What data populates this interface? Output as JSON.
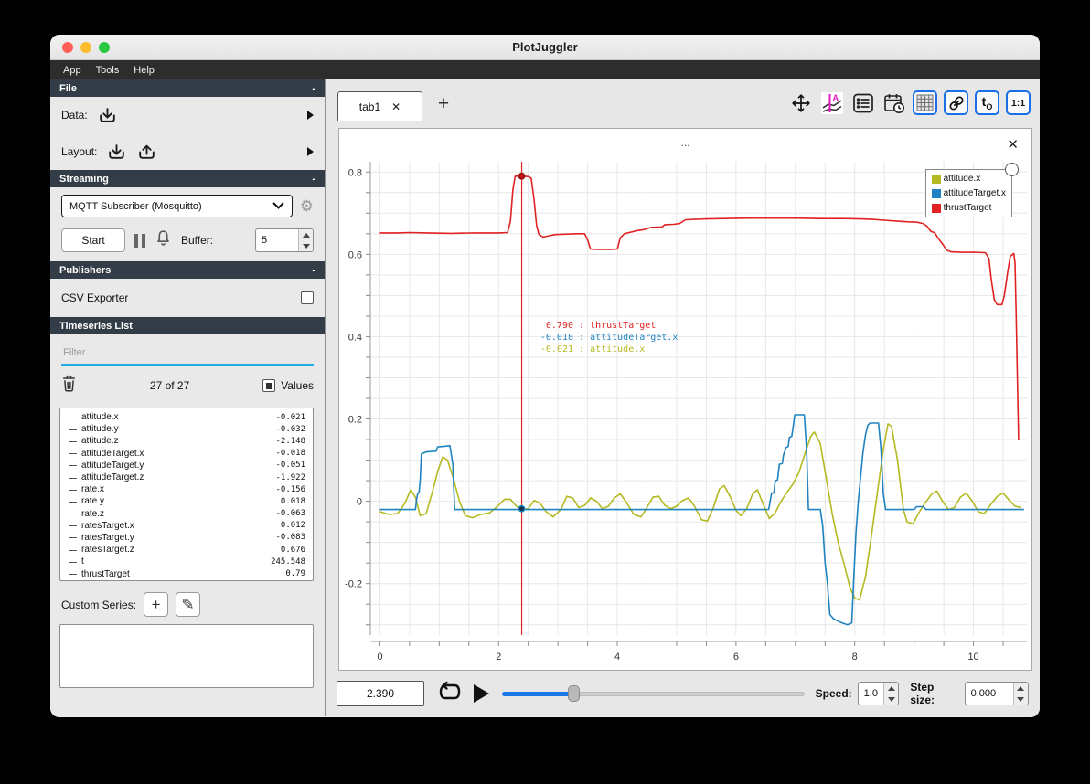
{
  "window": {
    "title": "PlotJuggler",
    "menu": [
      "App",
      "Tools",
      "Help"
    ],
    "traffic_lights": [
      "#ff5f57",
      "#febc2e",
      "#28c840"
    ]
  },
  "sidebar": {
    "file": {
      "header": "File",
      "collapse": "-",
      "data_label": "Data:",
      "layout_label": "Layout:"
    },
    "streaming": {
      "header": "Streaming",
      "collapse": "-",
      "source_selected": "MQTT Subscriber (Mosquitto)",
      "start_label": "Start",
      "buffer_label": "Buffer:",
      "buffer_value": "5"
    },
    "publishers": {
      "header": "Publishers",
      "collapse": "-",
      "csv_label": "CSV Exporter"
    },
    "timeseries": {
      "header": "Timeseries List",
      "filter_placeholder": "Filter...",
      "count": "27 of 27",
      "values_label": "Values",
      "items": [
        {
          "name": "attitude.x",
          "value": "-0.021"
        },
        {
          "name": "attitude.y",
          "value": "-0.032"
        },
        {
          "name": "attitude.z",
          "value": "-2.148"
        },
        {
          "name": "attitudeTarget.x",
          "value": "-0.018"
        },
        {
          "name": "attitudeTarget.y",
          "value": "-0.051"
        },
        {
          "name": "attitudeTarget.z",
          "value": "-1.922"
        },
        {
          "name": "rate.x",
          "value": "-0.156"
        },
        {
          "name": "rate.y",
          "value": "0.018"
        },
        {
          "name": "rate.z",
          "value": "-0.063"
        },
        {
          "name": "ratesTarget.x",
          "value": "0.012"
        },
        {
          "name": "ratesTarget.y",
          "value": "-0.083"
        },
        {
          "name": "ratesTarget.z",
          "value": "0.676"
        },
        {
          "name": "t",
          "value": "245.548"
        },
        {
          "name": "thrustTarget",
          "value": "0.79"
        }
      ]
    },
    "custom_series": {
      "label": "Custom Series:",
      "add_glyph": "+",
      "edit_glyph": "✎"
    }
  },
  "tabbar": {
    "active_tab": "tab1",
    "close_glyph": "✕",
    "add_glyph": "+"
  },
  "plot": {
    "title": "...",
    "close_glyph": "✕",
    "legend": [
      {
        "label": "attitude.x",
        "color": "#b4b921"
      },
      {
        "label": "attitudeTarget.x",
        "color": "#1f83c1"
      },
      {
        "label": "thrustTarget",
        "color": "#e02222"
      }
    ],
    "tooltip": [
      {
        "value": "0.790",
        "name": "thrustTarget",
        "color": "#e02222"
      },
      {
        "value": "-0.018",
        "name": "attitudeTarget.x",
        "color": "#1f83c1"
      },
      {
        "value": "-0.021",
        "name": "attitude.x",
        "color": "#b4b921"
      }
    ]
  },
  "chart_data": {
    "type": "line",
    "xlim": [
      -0.16,
      10.9
    ],
    "ylim": [
      -0.325,
      0.825
    ],
    "x_ticks": [
      0,
      2,
      4,
      6,
      8,
      10
    ],
    "y_ticks": [
      0.8,
      0.6,
      0.4,
      0.2,
      0,
      -0.2
    ],
    "x_minor": 0.5,
    "y_minor": 0.05,
    "grid": true,
    "legend_position": "top-right",
    "tracker": {
      "t": 2.39,
      "dots": [
        {
          "v": 0.79,
          "fill": "#c41717",
          "stroke": "#8a0f0f"
        },
        {
          "v": -0.018,
          "fill": "#12364e",
          "stroke": "#1f83c1"
        }
      ]
    },
    "series": [
      {
        "name": "attitude.x",
        "color": "#b4b921",
        "points": [
          [
            0,
            -0.025
          ],
          [
            0.15,
            -0.032
          ],
          [
            0.3,
            -0.03
          ],
          [
            0.42,
            -0.005
          ],
          [
            0.52,
            0.028
          ],
          [
            0.6,
            0.01
          ],
          [
            0.68,
            -0.035
          ],
          [
            0.78,
            -0.03
          ],
          [
            0.88,
            0.02
          ],
          [
            0.98,
            0.075
          ],
          [
            1.06,
            0.108
          ],
          [
            1.14,
            0.1
          ],
          [
            1.24,
            0.055
          ],
          [
            1.34,
            0
          ],
          [
            1.44,
            -0.035
          ],
          [
            1.56,
            -0.04
          ],
          [
            1.7,
            -0.032
          ],
          [
            1.85,
            -0.028
          ],
          [
            2,
            -0.01
          ],
          [
            2.1,
            0.005
          ],
          [
            2.2,
            0.005
          ],
          [
            2.3,
            -0.012
          ],
          [
            2.39,
            -0.021
          ],
          [
            2.5,
            -0.018
          ],
          [
            2.6,
            0.002
          ],
          [
            2.7,
            -0.005
          ],
          [
            2.8,
            -0.025
          ],
          [
            2.92,
            -0.038
          ],
          [
            3.05,
            -0.02
          ],
          [
            3.15,
            0.012
          ],
          [
            3.25,
            0.008
          ],
          [
            3.35,
            -0.015
          ],
          [
            3.45,
            -0.01
          ],
          [
            3.55,
            0.008
          ],
          [
            3.65,
            0
          ],
          [
            3.75,
            -0.018
          ],
          [
            3.85,
            -0.012
          ],
          [
            3.95,
            0.008
          ],
          [
            4.05,
            0.018
          ],
          [
            4.15,
            -0.002
          ],
          [
            4.28,
            -0.032
          ],
          [
            4.4,
            -0.038
          ],
          [
            4.5,
            -0.015
          ],
          [
            4.6,
            0.01
          ],
          [
            4.7,
            0.012
          ],
          [
            4.8,
            -0.01
          ],
          [
            4.9,
            -0.018
          ],
          [
            5,
            -0.012
          ],
          [
            5.1,
            0.002
          ],
          [
            5.2,
            0.008
          ],
          [
            5.3,
            -0.012
          ],
          [
            5.42,
            -0.045
          ],
          [
            5.52,
            -0.048
          ],
          [
            5.62,
            -0.015
          ],
          [
            5.72,
            0.03
          ],
          [
            5.8,
            0.038
          ],
          [
            5.9,
            0.012
          ],
          [
            6,
            -0.022
          ],
          [
            6.08,
            -0.035
          ],
          [
            6.18,
            -0.018
          ],
          [
            6.28,
            0.018
          ],
          [
            6.36,
            0.028
          ],
          [
            6.46,
            -0.008
          ],
          [
            6.56,
            -0.042
          ],
          [
            6.66,
            -0.028
          ],
          [
            6.76,
            0
          ],
          [
            6.86,
            0.022
          ],
          [
            6.96,
            0.042
          ],
          [
            7.06,
            0.07
          ],
          [
            7.16,
            0.115
          ],
          [
            7.26,
            0.158
          ],
          [
            7.32,
            0.168
          ],
          [
            7.42,
            0.14
          ],
          [
            7.52,
            0.055
          ],
          [
            7.62,
            -0.03
          ],
          [
            7.72,
            -0.1
          ],
          [
            7.82,
            -0.152
          ],
          [
            7.92,
            -0.21
          ],
          [
            8,
            -0.235
          ],
          [
            8.08,
            -0.24
          ],
          [
            8.18,
            -0.185
          ],
          [
            8.28,
            -0.085
          ],
          [
            8.38,
            0.02
          ],
          [
            8.48,
            0.125
          ],
          [
            8.56,
            0.188
          ],
          [
            8.62,
            0.182
          ],
          [
            8.72,
            0.1
          ],
          [
            8.82,
            -0.02
          ],
          [
            8.88,
            -0.05
          ],
          [
            8.98,
            -0.055
          ],
          [
            9.08,
            -0.028
          ],
          [
            9.18,
            -0.005
          ],
          [
            9.3,
            0.018
          ],
          [
            9.38,
            0.025
          ],
          [
            9.48,
            0
          ],
          [
            9.58,
            -0.02
          ],
          [
            9.68,
            -0.015
          ],
          [
            9.78,
            0.01
          ],
          [
            9.88,
            0.02
          ],
          [
            9.98,
            0
          ],
          [
            10.08,
            -0.025
          ],
          [
            10.18,
            -0.03
          ],
          [
            10.28,
            -0.01
          ],
          [
            10.4,
            0.012
          ],
          [
            10.5,
            0.02
          ],
          [
            10.6,
            0.003
          ],
          [
            10.7,
            -0.012
          ],
          [
            10.8,
            -0.015
          ]
        ]
      },
      {
        "name": "attitudeTarget.x",
        "color": "#1f83c1",
        "points": [
          [
            0,
            -0.02
          ],
          [
            0.6,
            -0.02
          ],
          [
            0.62,
            0.005
          ],
          [
            0.64,
            0.02
          ],
          [
            0.66,
            0.02
          ],
          [
            0.68,
            0.05
          ],
          [
            0.7,
            0.115
          ],
          [
            0.78,
            0.12
          ],
          [
            0.95,
            0.122
          ],
          [
            0.97,
            0.132
          ],
          [
            1.18,
            0.135
          ],
          [
            1.23,
            0.09
          ],
          [
            1.26,
            -0.02
          ],
          [
            6.55,
            -0.02
          ],
          [
            6.58,
            0.005
          ],
          [
            6.6,
            0.02
          ],
          [
            6.64,
            0.02
          ],
          [
            6.66,
            0.05
          ],
          [
            6.7,
            0.052
          ],
          [
            6.73,
            0.09
          ],
          [
            6.78,
            0.092
          ],
          [
            6.8,
            0.112
          ],
          [
            6.84,
            0.13
          ],
          [
            6.88,
            0.133
          ],
          [
            6.9,
            0.155
          ],
          [
            6.94,
            0.158
          ],
          [
            6.96,
            0.178
          ],
          [
            6.99,
            0.21
          ],
          [
            7.15,
            0.21
          ],
          [
            7.19,
            0.12
          ],
          [
            7.22,
            -0.02
          ],
          [
            7.42,
            -0.02
          ],
          [
            7.46,
            -0.06
          ],
          [
            7.5,
            -0.15
          ],
          [
            7.54,
            -0.2
          ],
          [
            7.58,
            -0.275
          ],
          [
            7.64,
            -0.285
          ],
          [
            7.7,
            -0.29
          ],
          [
            7.78,
            -0.295
          ],
          [
            7.88,
            -0.3
          ],
          [
            7.95,
            -0.295
          ],
          [
            7.98,
            -0.2
          ],
          [
            8.02,
            -0.08
          ],
          [
            8.06,
            0
          ],
          [
            8.1,
            0.06
          ],
          [
            8.14,
            0.12
          ],
          [
            8.18,
            0.16
          ],
          [
            8.22,
            0.185
          ],
          [
            8.26,
            0.19
          ],
          [
            8.4,
            0.19
          ],
          [
            8.44,
            0.13
          ],
          [
            8.48,
            0.02
          ],
          [
            8.52,
            -0.02
          ],
          [
            9,
            -0.02
          ],
          [
            9.04,
            -0.013
          ],
          [
            9.16,
            -0.013
          ],
          [
            9.2,
            -0.02
          ],
          [
            10.85,
            -0.02
          ]
        ]
      },
      {
        "name": "thrustTarget",
        "color": "#e02222",
        "points": [
          [
            0,
            0.652
          ],
          [
            0.3,
            0.652
          ],
          [
            0.5,
            0.653
          ],
          [
            0.8,
            0.652
          ],
          [
            1.2,
            0.651
          ],
          [
            1.6,
            0.652
          ],
          [
            2,
            0.652
          ],
          [
            2.15,
            0.653
          ],
          [
            2.2,
            0.68
          ],
          [
            2.24,
            0.755
          ],
          [
            2.28,
            0.79
          ],
          [
            2.39,
            0.79
          ],
          [
            2.5,
            0.789
          ],
          [
            2.55,
            0.785
          ],
          [
            2.6,
            0.73
          ],
          [
            2.64,
            0.67
          ],
          [
            2.68,
            0.648
          ],
          [
            2.75,
            0.642
          ],
          [
            2.85,
            0.645
          ],
          [
            2.95,
            0.648
          ],
          [
            3.1,
            0.649
          ],
          [
            3.3,
            0.65
          ],
          [
            3.45,
            0.65
          ],
          [
            3.5,
            0.635
          ],
          [
            3.55,
            0.613
          ],
          [
            3.65,
            0.612
          ],
          [
            3.9,
            0.612
          ],
          [
            4,
            0.613
          ],
          [
            4.05,
            0.64
          ],
          [
            4.12,
            0.65
          ],
          [
            4.2,
            0.653
          ],
          [
            4.35,
            0.658
          ],
          [
            4.45,
            0.66
          ],
          [
            4.55,
            0.665
          ],
          [
            4.65,
            0.666
          ],
          [
            4.75,
            0.666
          ],
          [
            4.8,
            0.672
          ],
          [
            4.95,
            0.673
          ],
          [
            5.05,
            0.675
          ],
          [
            5.15,
            0.684
          ],
          [
            5.3,
            0.685
          ],
          [
            5.5,
            0.686
          ],
          [
            5.8,
            0.687
          ],
          [
            6.2,
            0.688
          ],
          [
            6.6,
            0.688
          ],
          [
            7,
            0.688
          ],
          [
            7.4,
            0.687
          ],
          [
            7.8,
            0.687
          ],
          [
            8.1,
            0.686
          ],
          [
            8.3,
            0.685
          ],
          [
            8.5,
            0.683
          ],
          [
            8.7,
            0.681
          ],
          [
            8.9,
            0.679
          ],
          [
            9.05,
            0.678
          ],
          [
            9.15,
            0.675
          ],
          [
            9.22,
            0.668
          ],
          [
            9.28,
            0.656
          ],
          [
            9.35,
            0.652
          ],
          [
            9.4,
            0.64
          ],
          [
            9.48,
            0.625
          ],
          [
            9.55,
            0.61
          ],
          [
            9.62,
            0.606
          ],
          [
            9.8,
            0.605
          ],
          [
            10,
            0.605
          ],
          [
            10.2,
            0.604
          ],
          [
            10.26,
            0.59
          ],
          [
            10.3,
            0.54
          ],
          [
            10.35,
            0.49
          ],
          [
            10.4,
            0.478
          ],
          [
            10.48,
            0.478
          ],
          [
            10.52,
            0.5
          ],
          [
            10.58,
            0.56
          ],
          [
            10.62,
            0.595
          ],
          [
            10.68,
            0.602
          ],
          [
            10.7,
            0.58
          ],
          [
            10.72,
            0.45
          ],
          [
            10.74,
            0.3
          ],
          [
            10.76,
            0.15
          ]
        ]
      }
    ]
  },
  "playback": {
    "time": "2.390",
    "slider_fraction": 0.235,
    "speed_label": "Speed:",
    "speed": "1.0",
    "step_label": "Step size:",
    "step": "0.000"
  }
}
